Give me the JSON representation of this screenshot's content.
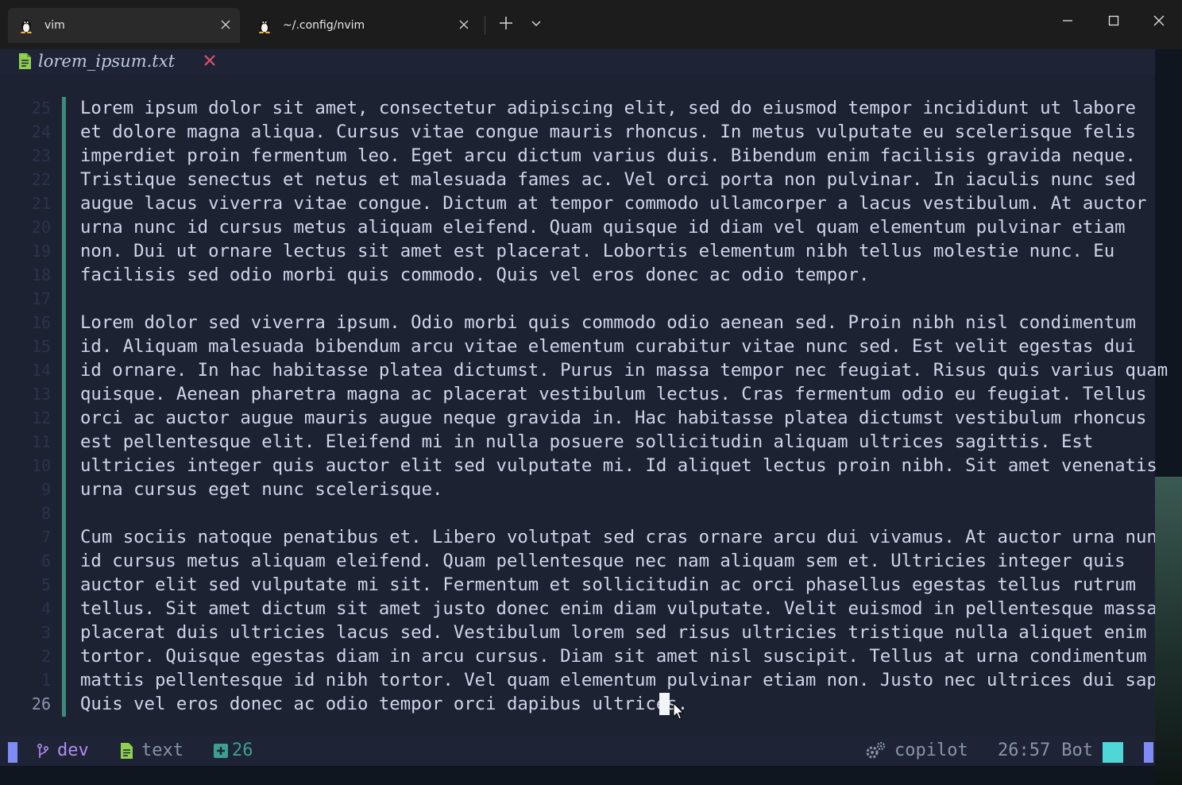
{
  "tabs": [
    {
      "title": "vim",
      "active": true
    },
    {
      "title": "~/.config/nvim",
      "active": false
    }
  ],
  "window_controls": [
    "minimize-icon",
    "maximize-icon",
    "close-icon"
  ],
  "bufferline": {
    "filename": "lorem_ipsum.txt",
    "modified_color": "#e0506a",
    "icon_color": "#8fd14f"
  },
  "editor": {
    "line_numbers": [
      "25",
      "24",
      "23",
      "22",
      "21",
      "20",
      "19",
      "18",
      "17",
      "16",
      "15",
      "14",
      "13",
      "12",
      "11",
      "10",
      "9",
      "8",
      "7",
      "6",
      "5",
      "4",
      "3",
      "2",
      "1",
      "26"
    ],
    "lines": [
      "Lorem ipsum dolor sit amet, consectetur adipiscing elit, sed do eiusmod tempor incididunt ut labore",
      "et dolore magna aliqua. Cursus vitae congue mauris rhoncus. In metus vulputate eu scelerisque felis",
      "imperdiet proin fermentum leo. Eget arcu dictum varius duis. Bibendum enim facilisis gravida neque.",
      "Tristique senectus et netus et malesuada fames ac. Vel orci porta non pulvinar. In iaculis nunc sed",
      "augue lacus viverra vitae congue. Dictum at tempor commodo ullamcorper a lacus vestibulum. At auctor",
      "urna nunc id cursus metus aliquam eleifend. Quam quisque id diam vel quam elementum pulvinar etiam",
      "non. Dui ut ornare lectus sit amet est placerat. Lobortis elementum nibh tellus molestie nunc. Eu",
      "facilisis sed odio morbi quis commodo. Quis vel eros donec ac odio tempor.",
      "",
      "Lorem dolor sed viverra ipsum. Odio morbi quis commodo odio aenean sed. Proin nibh nisl condimentum",
      "id. Aliquam malesuada bibendum arcu vitae elementum curabitur vitae nunc sed. Est velit egestas dui",
      "id ornare. In hac habitasse platea dictumst. Purus in massa tempor nec feugiat. Risus quis varius quam",
      "quisque. Aenean pharetra magna ac placerat vestibulum lectus. Cras fermentum odio eu feugiat. Tellus",
      "orci ac auctor augue mauris augue neque gravida in. Hac habitasse platea dictumst vestibulum rhoncus",
      "est pellentesque elit. Eleifend mi in nulla posuere sollicitudin aliquam ultrices sagittis. Est",
      "ultricies integer quis auctor elit sed vulputate mi. Id aliquet lectus proin nibh. Sit amet venenatis",
      "urna cursus eget nunc scelerisque.",
      "",
      "Cum sociis natoque penatibus et. Libero volutpat sed cras ornare arcu dui vivamus. At auctor urna nunc",
      "id cursus metus aliquam eleifend. Quam pellentesque nec nam aliquam sem et. Ultricies integer quis",
      "auctor elit sed vulputate mi sit. Fermentum et sollicitudin ac orci phasellus egestas tellus rutrum",
      "tellus. Sit amet dictum sit amet justo donec enim diam vulputate. Velit euismod in pellentesque massa",
      "placerat duis ultricies lacus sed. Vestibulum lorem sed risus ultricies tristique nulla aliquet enim",
      "tortor. Quisque egestas diam in arcu cursus. Diam sit amet nisl suscipit. Tellus at urna condimentum",
      "mattis pellentesque id nibh tortor. Vel quam elementum pulvinar etiam non. Justo nec ultrices dui sapien",
      "Quis vel eros donec ac odio tempor orci dapibus ultrices."
    ],
    "current_line_index": 25
  },
  "statusline": {
    "branch": "dev",
    "filetype": "text",
    "diff_added": "26",
    "lsp": "copilot",
    "position": "26:57",
    "scroll": "Bot",
    "mode_color": "#7f8cf5",
    "branch_color": "#b48bf2",
    "diff_color": "#3f9e8f",
    "scroll_color": "#4fd6d6"
  }
}
